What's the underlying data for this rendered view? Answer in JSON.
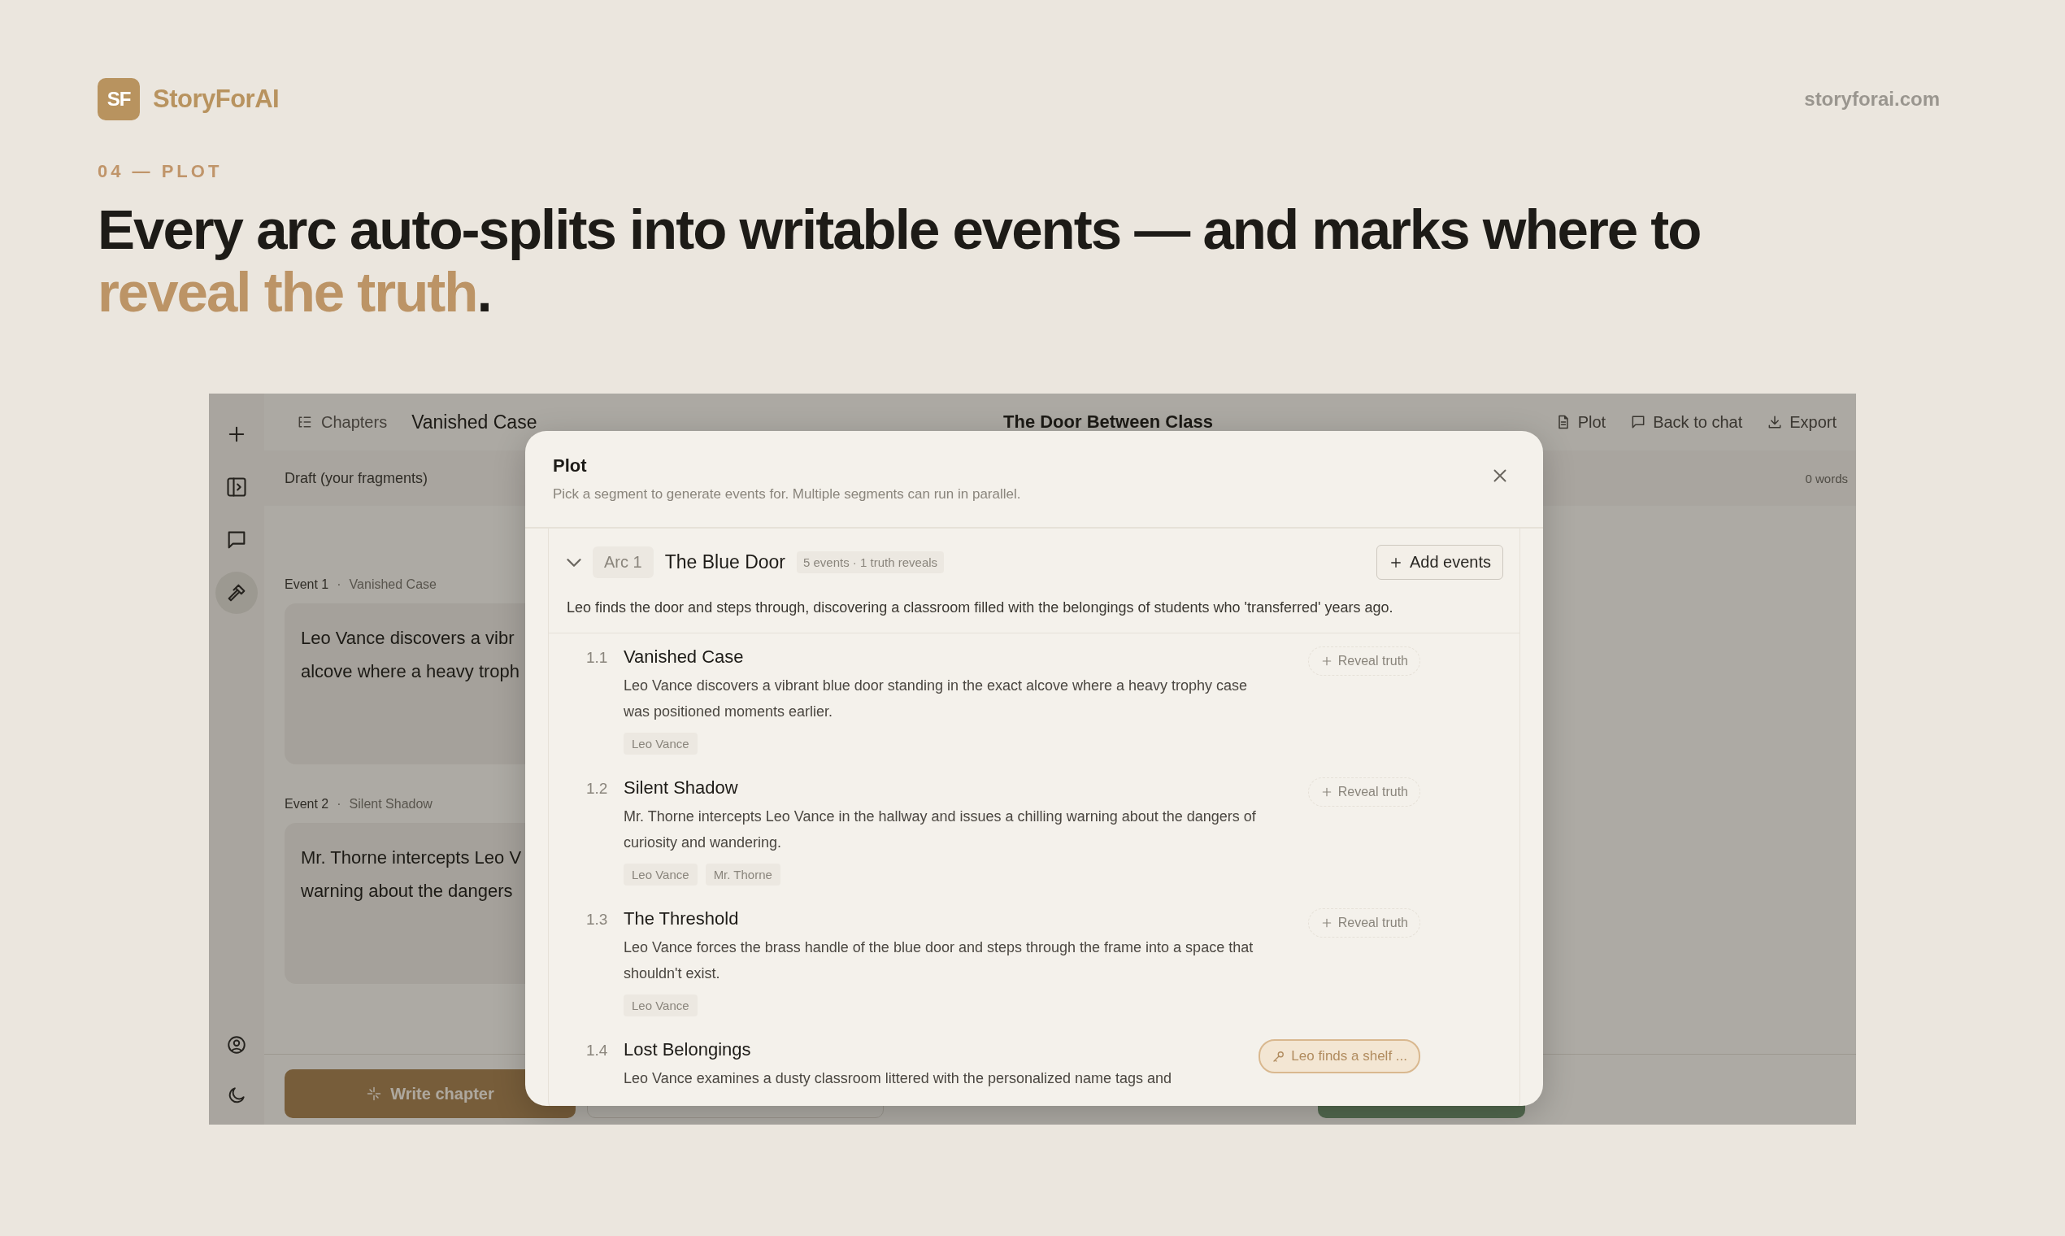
{
  "brand": {
    "logo": "SF",
    "name": "StoryForAI",
    "url": "storyforai.com"
  },
  "section_label": "04 — PLOT",
  "headline": "Every arc auto-splits into writable events — and marks where to **reveal the truth**.",
  "app": {
    "rail_items": [
      {
        "kind": "new",
        "selected": false
      },
      {
        "kind": "panel",
        "selected": false
      },
      {
        "kind": "chat",
        "selected": false
      },
      {
        "kind": "tools",
        "selected": true
      }
    ],
    "rail_bottom": [
      {
        "kind": "account"
      },
      {
        "kind": "theme"
      }
    ],
    "topbar": {
      "chapters_button": "Chapters",
      "chapter_title": "Vanished Case",
      "book_title": "The Door Between Class",
      "actions": [
        {
          "kind": "plot",
          "label": "Plot"
        },
        {
          "kind": "chat",
          "label": "Back to chat"
        },
        {
          "kind": "export",
          "label": "Export"
        }
      ]
    },
    "draft_bar": {
      "label": "Draft (your fragments)",
      "word_count": "0 words"
    },
    "events": [
      {
        "label": "Event 1",
        "separator": "·",
        "name": "Vanished Case",
        "lines": [
          "Leo Vance discovers a vibr",
          "alcove where a heavy troph"
        ]
      },
      {
        "label": "Event 2",
        "separator": "·",
        "name": "Silent Shadow",
        "lines": [
          "Mr. Thorne intercepts Leo V",
          "warning about the dangers"
        ]
      }
    ],
    "bottom_bar": {
      "write_button": "Write chapter"
    },
    "modal": {
      "title": "Plot",
      "subtitle": "Pick a segment to generate events for. Multiple segments can run in parallel.",
      "arc": {
        "expanded": true,
        "number": "Arc 1",
        "title": "The Blue Door",
        "badge": "5 events · 1 truth reveals",
        "add_button": "Add events",
        "summary": "Leo finds the door and steps through, discovering a classroom filled with the belongings of students who 'transferred' years ago.",
        "events": [
          {
            "number": "1.1",
            "title": "Vanished Case",
            "description": "Leo Vance discovers a vibrant blue door standing in the exact alcove where a heavy trophy case was positioned moments earlier.",
            "characters": [
              "Leo Vance"
            ],
            "reveal": {
              "kind": "add",
              "label": "Reveal truth"
            }
          },
          {
            "number": "1.2",
            "title": "Silent Shadow",
            "description": "Mr. Thorne intercepts Leo Vance in the hallway and issues a chilling warning about the dangers of curiosity and wandering.",
            "characters": [
              "Leo Vance",
              "Mr. Thorne"
            ],
            "reveal": {
              "kind": "add",
              "label": "Reveal truth"
            }
          },
          {
            "number": "1.3",
            "title": "The Threshold",
            "description": "Leo Vance forces the brass handle of the blue door and steps through the frame into a space that shouldn't exist.",
            "characters": [
              "Leo Vance"
            ],
            "reveal": {
              "kind": "add",
              "label": "Reveal truth"
            }
          },
          {
            "number": "1.4",
            "title": "Lost Belongings",
            "description": "Leo Vance examines a dusty classroom littered with the personalized name tags and",
            "reveal": {
              "kind": "set",
              "label": "Leo finds a shelf ..."
            }
          }
        ]
      }
    }
  }
}
